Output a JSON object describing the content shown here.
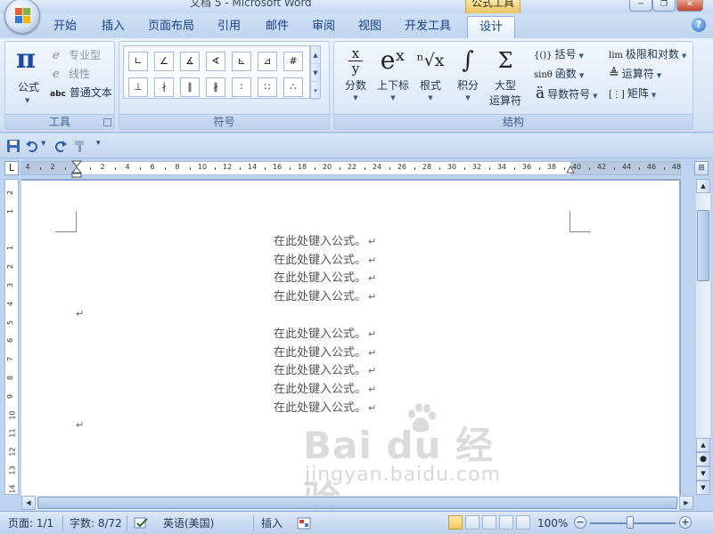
{
  "window": {
    "title": "文档 5 - Microsoft Word",
    "context_tab_title": "公式工具",
    "minimize_glyph": "─",
    "restore_glyph": "❐",
    "close_glyph": "✕"
  },
  "tabs": [
    {
      "label": "开始",
      "selected": false
    },
    {
      "label": "插入",
      "selected": false
    },
    {
      "label": "页面布局",
      "selected": false
    },
    {
      "label": "引用",
      "selected": false
    },
    {
      "label": "邮件",
      "selected": false
    },
    {
      "label": "审阅",
      "selected": false
    },
    {
      "label": "视图",
      "selected": false
    },
    {
      "label": "开发工具",
      "selected": false
    },
    {
      "label": "设计",
      "selected": true
    }
  ],
  "help_glyph": "?",
  "ribbon": {
    "tools_group": {
      "label": "工具",
      "equation_glyph": "π",
      "equation_label": "公式",
      "professional_label": "专业型",
      "linear_label": "线性",
      "normal_text_prefix": "abc",
      "normal_text_label": "普通文本"
    },
    "symbols_group": {
      "label": "符号",
      "symbols_row1": [
        "∟",
        "∠",
        "∡",
        "∢",
        "⊾",
        "⊿",
        "#"
      ],
      "symbols_row2": [
        "⊥",
        "∤",
        "∥",
        "∦",
        "∶",
        "∷",
        "∴"
      ]
    },
    "structures_group": {
      "label": "结构",
      "fraction": {
        "glyph_top": "x",
        "glyph_bottom": "y",
        "label": "分数"
      },
      "script": {
        "glyph": "eˣ",
        "label": "上下标"
      },
      "radical": {
        "glyph": "ⁿ√x",
        "label": "根式"
      },
      "integral": {
        "glyph": "∫",
        "label": "积分"
      },
      "large_operator": {
        "glyph": "Σ",
        "label_line1": "大型",
        "label_line2": "运算符"
      },
      "bracket": {
        "icon": "{()}",
        "label": "括号"
      },
      "function": {
        "icon": "sinθ",
        "label": "函数"
      },
      "accent": {
        "icon": "ä",
        "label": "导数符号"
      },
      "limit_log": {
        "icon": "lim",
        "label": "极限和对数"
      },
      "operator": {
        "icon": "≜",
        "label": "运算符"
      },
      "matrix": {
        "icon": "[⋮]",
        "label": "矩阵"
      }
    }
  },
  "ruler": {
    "h_numbers": [
      "4",
      "2",
      "",
      "2",
      "4",
      "6",
      "8",
      "10",
      "12",
      "14",
      "16",
      "18",
      "20",
      "22",
      "24",
      "26",
      "28",
      "30",
      "32",
      "34",
      "36",
      "38",
      "40",
      "42",
      "44",
      "46",
      "48"
    ],
    "v_numbers": [
      "2",
      "1",
      "",
      "1",
      "2",
      "3",
      "4",
      "5",
      "6",
      "7",
      "8",
      "9",
      "10",
      "11",
      "12",
      "13",
      "14"
    ],
    "corner_glyph": "L"
  },
  "document": {
    "group1": [
      "在此处键入公式。",
      "在此处键入公式。",
      "在此处键入公式。",
      "在此处键入公式。"
    ],
    "group2": [
      "在此处键入公式。",
      "在此处键入公式。",
      "在此处键入公式。",
      "在此处键入公式。",
      "在此处键入公式。"
    ],
    "paragraph_mark": "↵"
  },
  "watermark": {
    "logo": "Bai du 经验",
    "url": "jingyan.baidu.com"
  },
  "statusbar": {
    "page": "页面: 1/1",
    "words": "字数: 8/72",
    "language": "英语(美国)",
    "insert_mode": "插入",
    "zoom": "100%",
    "zoom_out": "−",
    "zoom_in": "+"
  }
}
